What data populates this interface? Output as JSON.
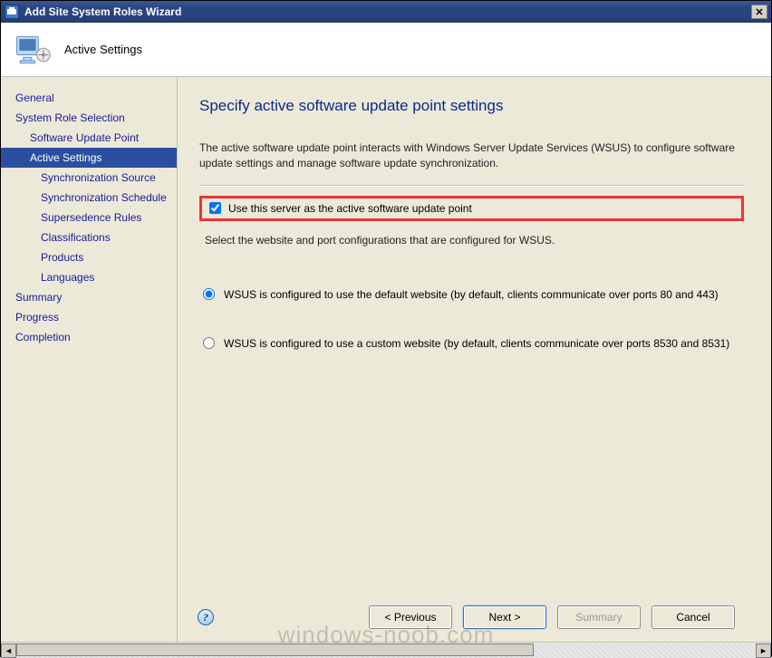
{
  "window": {
    "title": "Add Site System Roles Wizard"
  },
  "header": {
    "section_title": "Active Settings"
  },
  "nav": {
    "items": [
      {
        "label": "General",
        "indent": 0,
        "active": false
      },
      {
        "label": "System Role Selection",
        "indent": 0,
        "active": false
      },
      {
        "label": "Software Update Point",
        "indent": 1,
        "active": false
      },
      {
        "label": "Active Settings",
        "indent": 1,
        "active": true
      },
      {
        "label": "Synchronization Source",
        "indent": 2,
        "active": false
      },
      {
        "label": "Synchronization Schedule",
        "indent": 2,
        "active": false
      },
      {
        "label": "Supersedence Rules",
        "indent": 2,
        "active": false
      },
      {
        "label": "Classifications",
        "indent": 2,
        "active": false
      },
      {
        "label": "Products",
        "indent": 2,
        "active": false
      },
      {
        "label": "Languages",
        "indent": 2,
        "active": false
      },
      {
        "label": "Summary",
        "indent": 0,
        "active": false
      },
      {
        "label": "Progress",
        "indent": 0,
        "active": false
      },
      {
        "label": "Completion",
        "indent": 0,
        "active": false
      }
    ]
  },
  "page": {
    "title": "Specify active software update point settings",
    "description": "The active software update point interacts with Windows Server Update Services (WSUS) to configure software update settings and manage software update synchronization.",
    "checkbox_label": "Use this server as the active software update point",
    "checkbox_checked": true,
    "select_caption": "Select the website and port configurations that are configured for WSUS.",
    "radio_selected": "default",
    "radio_options": {
      "default": "WSUS is configured to use the default website (by default, clients communicate over ports 80 and 443)",
      "custom": "WSUS is configured to use a custom website (by default, clients communicate over ports 8530 and 8531)"
    }
  },
  "buttons": {
    "previous": "< Previous",
    "next": "Next >",
    "summary": "Summary",
    "cancel": "Cancel"
  },
  "watermark": "windows-noob.com"
}
